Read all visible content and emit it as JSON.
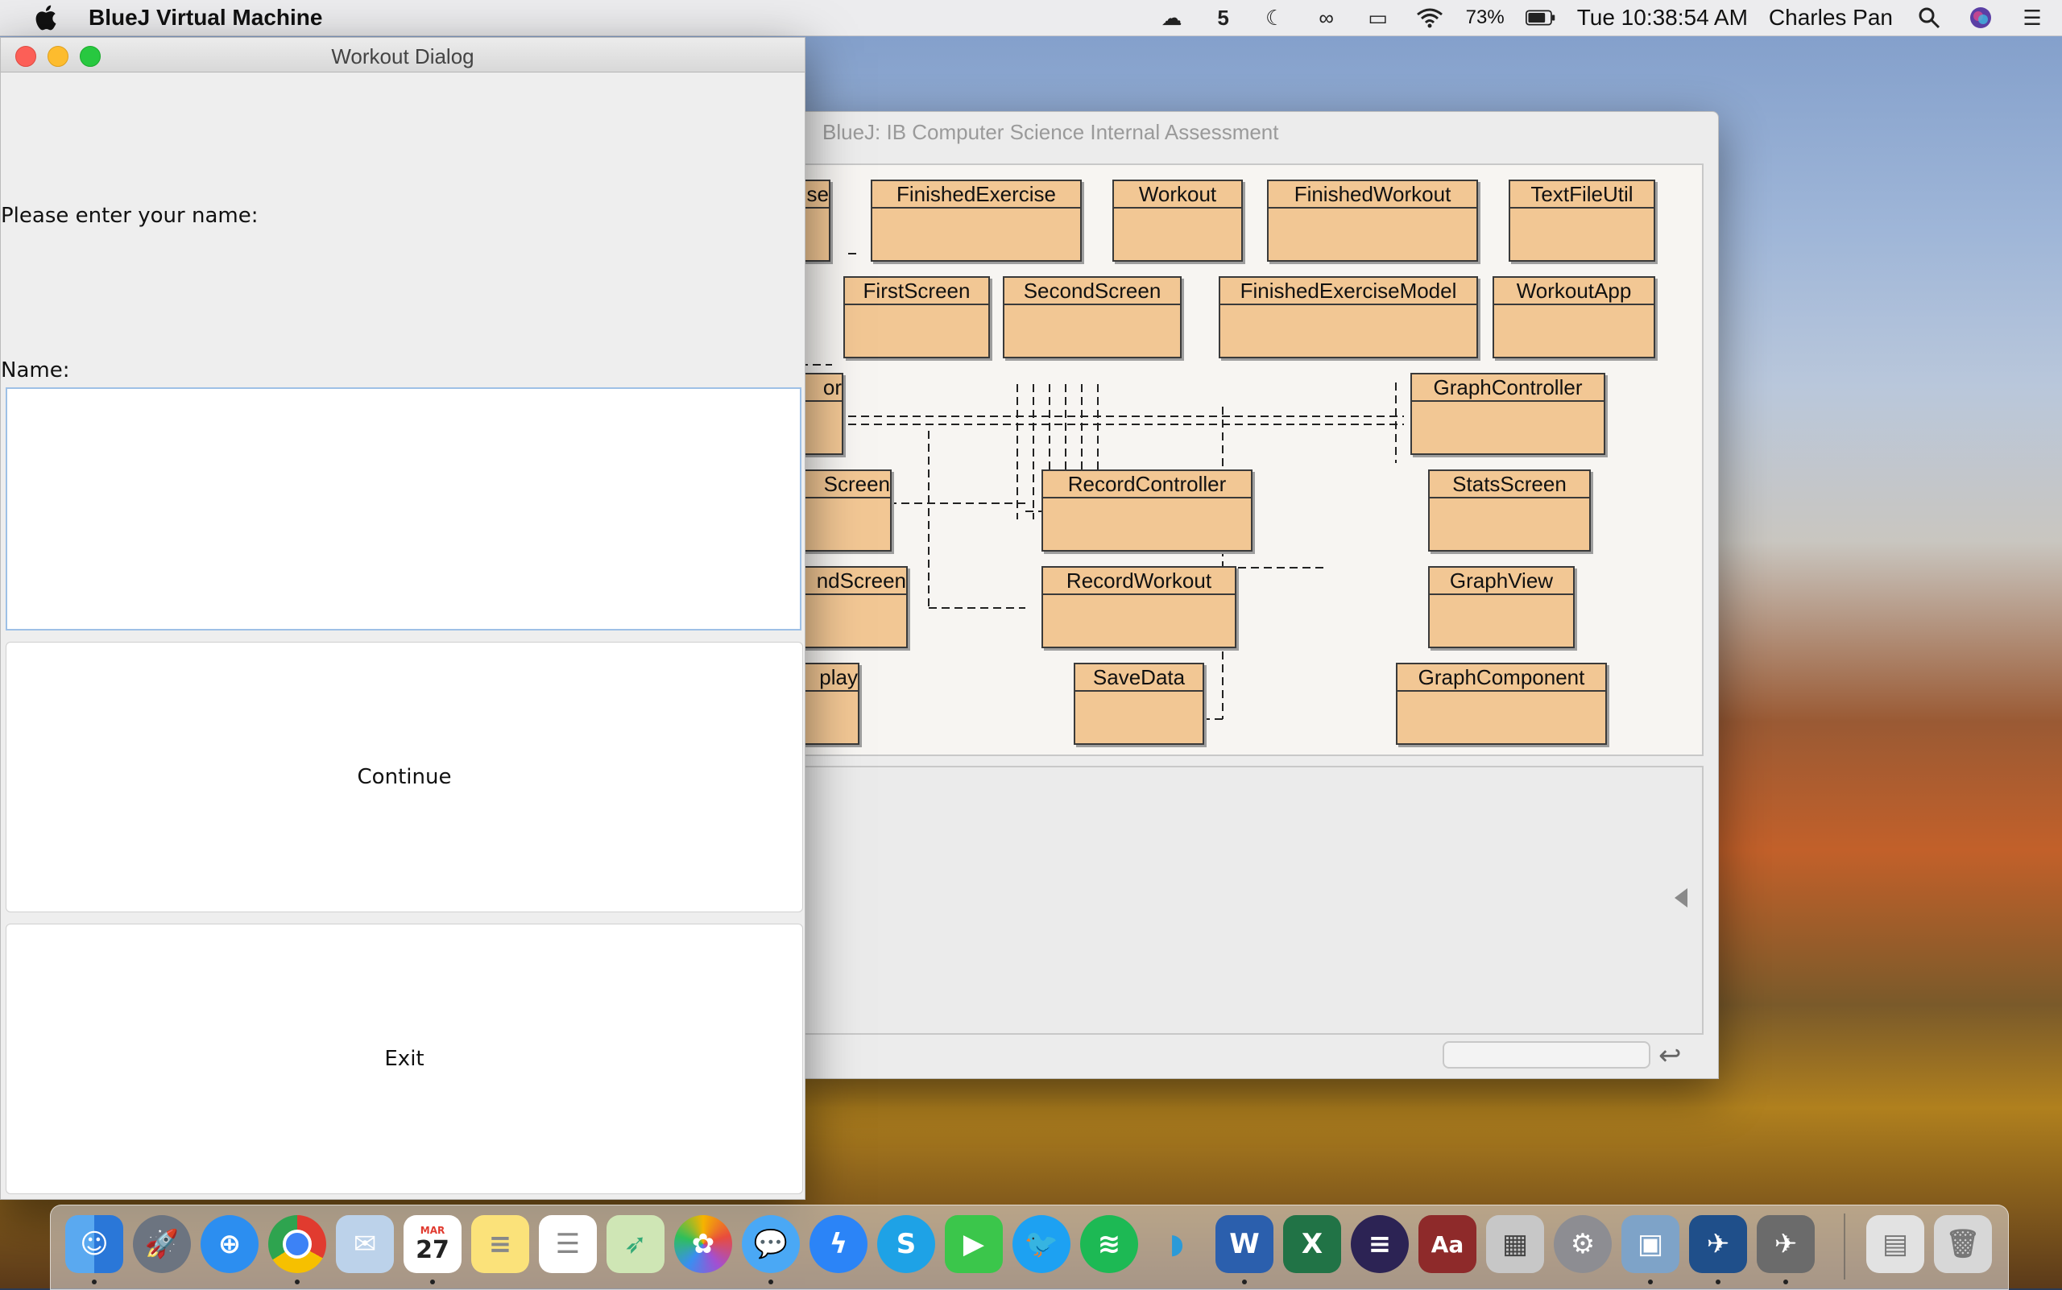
{
  "menubar": {
    "app_name": "BlueJ Virtual Machine",
    "battery": "73%",
    "clock": "Tue 10:38:54 AM",
    "user": "Charles Pan",
    "status_icons": [
      "cloud-upload-icon",
      "html5-icon",
      "moon-icon",
      "infinity-icon",
      "airplay-icon",
      "wifi-icon",
      "battery-icon"
    ]
  },
  "bluej": {
    "title": "BlueJ:  IB Computer Science Internal Assessment",
    "classes": [
      "se",
      "FinishedExercise",
      "Workout",
      "FinishedWorkout",
      "TextFileUtil",
      "FirstScreen",
      "SecondScreen",
      "FinishedExerciseModel",
      "WorkoutApp",
      "or",
      "GraphController",
      "Screen",
      "RecordController",
      "StatsScreen",
      "ndScreen",
      "RecordWorkout",
      "GraphView",
      "play",
      "SaveData",
      "GraphComponent"
    ]
  },
  "dialog": {
    "title": "Workout Dialog",
    "prompt": "Please enter your name:",
    "name_label": "Name:",
    "name_value": "",
    "continue_label": "Continue",
    "exit_label": "Exit"
  },
  "dock": {
    "apps": [
      "Finder",
      "Launchpad",
      "Safari",
      "Chrome",
      "Mail",
      "Calendar",
      "Notes",
      "Reminders",
      "Maps",
      "Photos",
      "Messages",
      "Messenger",
      "Skype",
      "FaceTime",
      "Twitter",
      "Spotify",
      "Dolphin",
      "Word",
      "Excel",
      "Eclipse",
      "Dictionary",
      "Calculator",
      "System Preferences",
      "Preview",
      "BlueJ",
      "Terminal",
      "Document",
      "Trash"
    ],
    "calendar_month": "MAR",
    "calendar_day": "27"
  }
}
